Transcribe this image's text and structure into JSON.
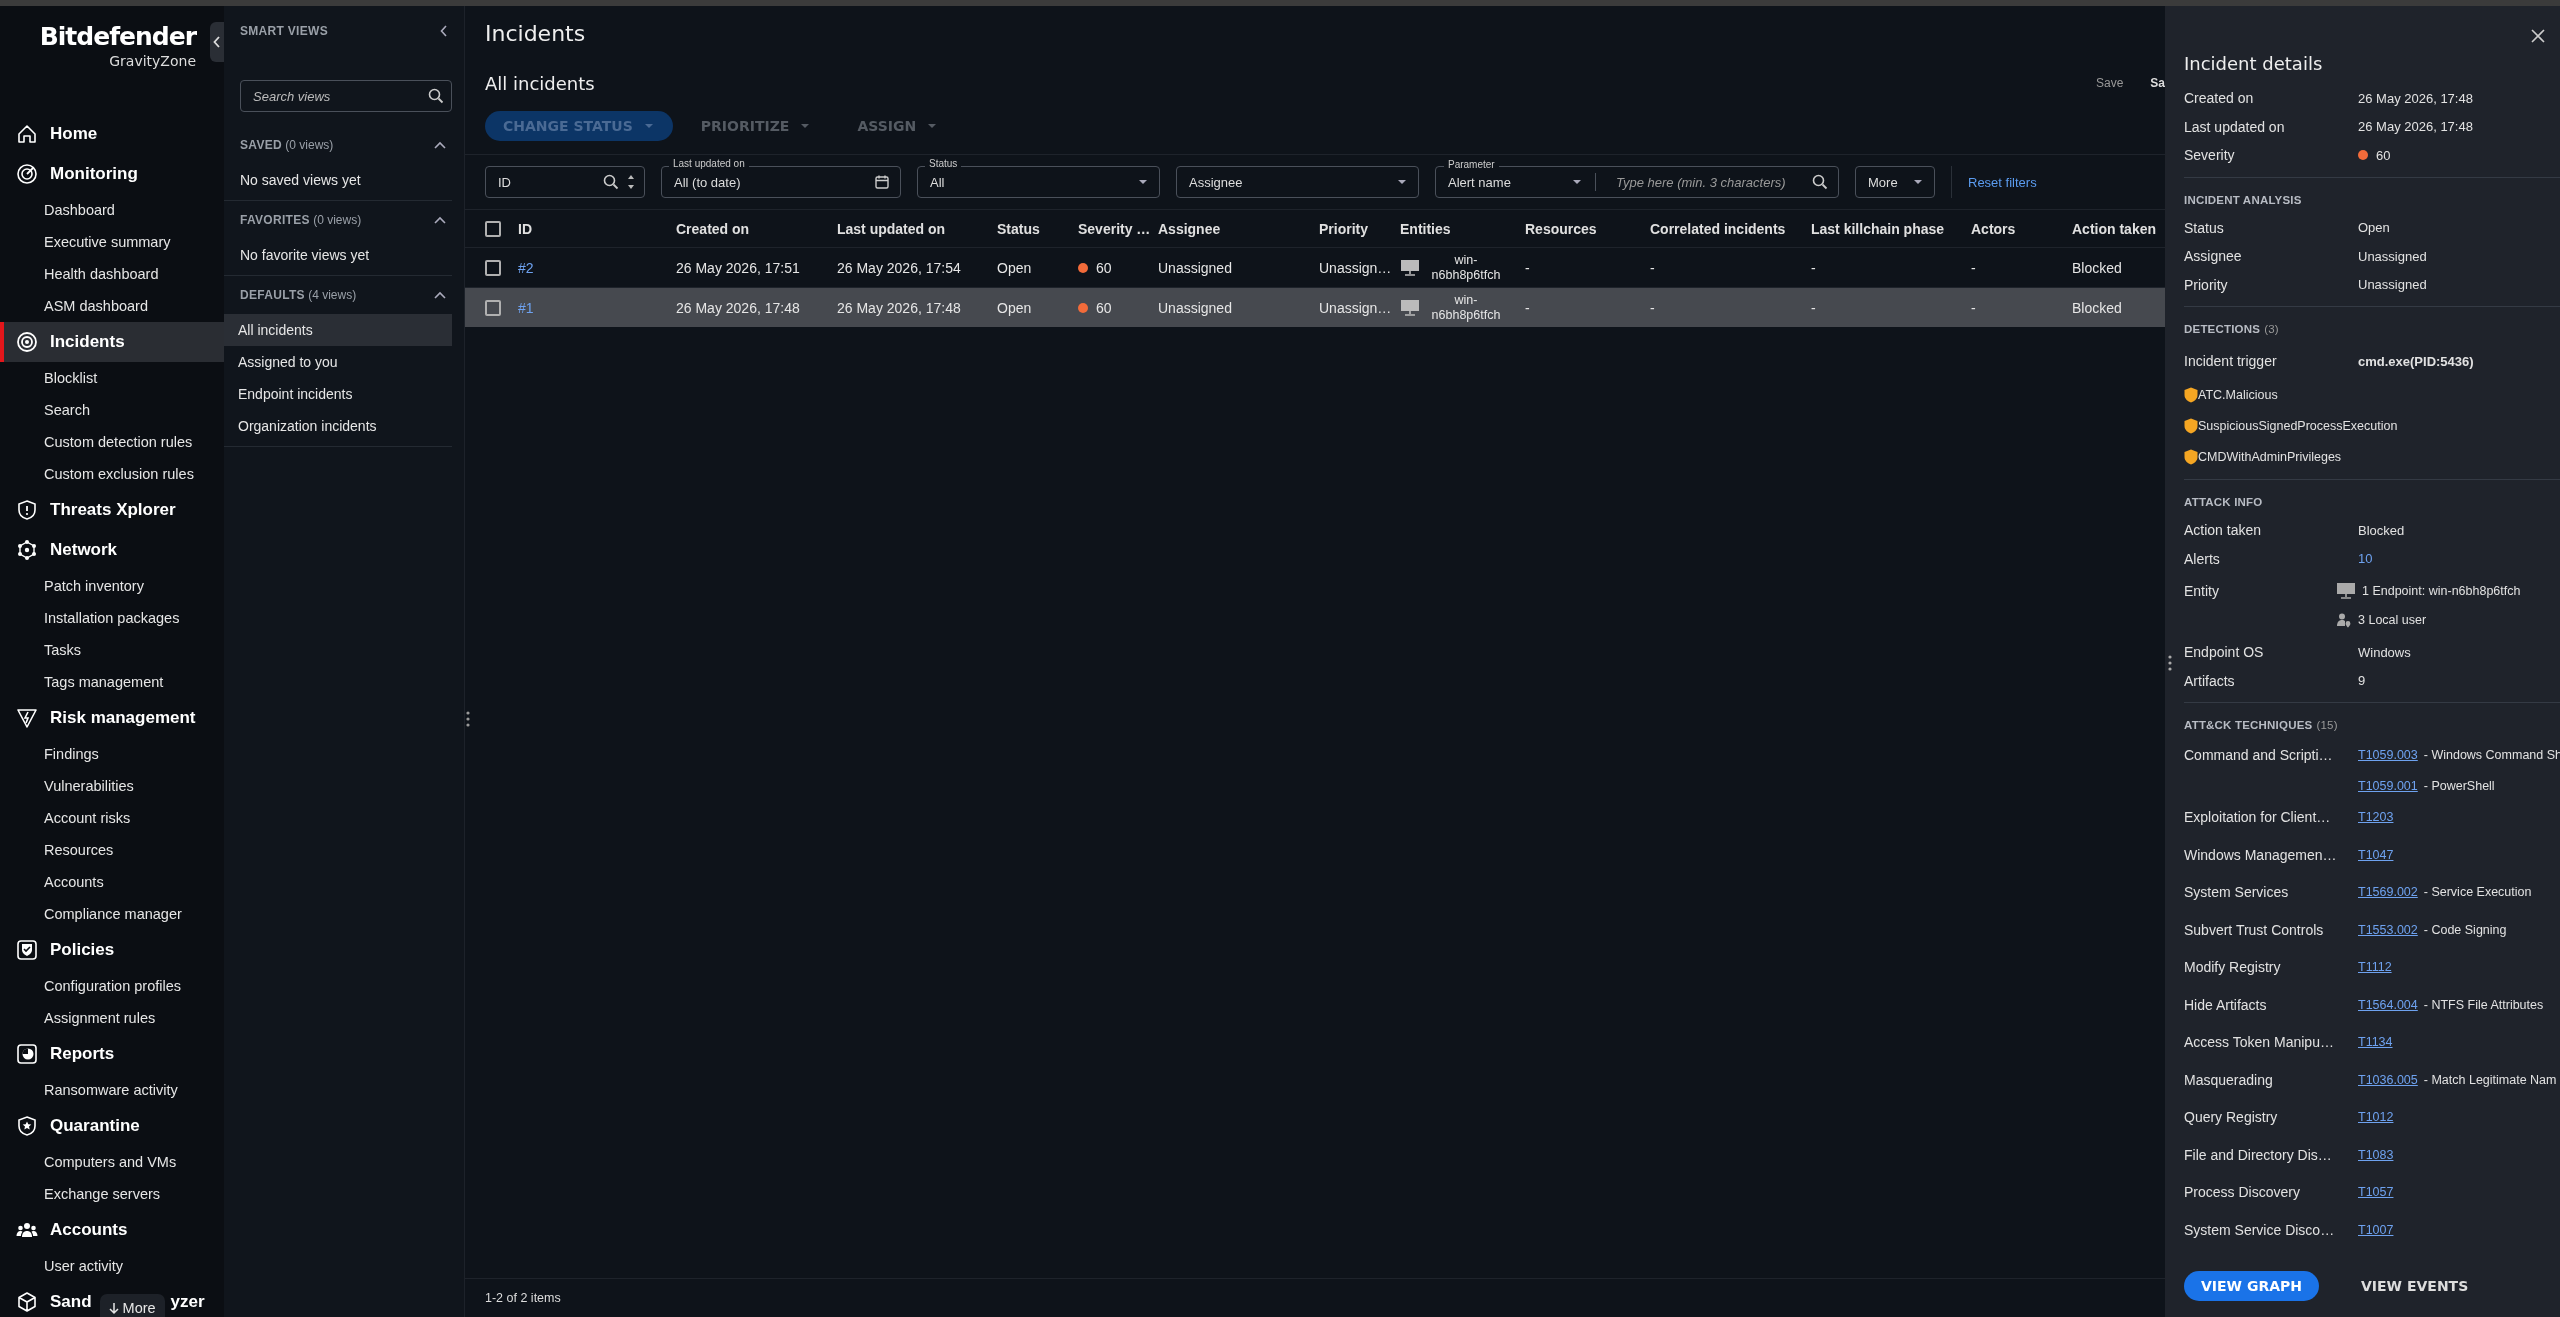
{
  "nav": {
    "brand": "Bitdefender",
    "product": "GravityZone",
    "more": "More",
    "sections": [
      {
        "label": "Home",
        "selected": false
      },
      {
        "label": "Monitoring",
        "selected": false,
        "items": [
          "Dashboard",
          "Executive summary",
          "Health dashboard",
          "ASM dashboard"
        ]
      },
      {
        "label": "Incidents",
        "selected": true,
        "items": [
          "Blocklist",
          "Search",
          "Custom detection rules",
          "Custom exclusion rules"
        ]
      },
      {
        "label": "Threats Xplorer",
        "selected": false
      },
      {
        "label": "Network",
        "selected": false,
        "items": [
          "Patch inventory",
          "Installation packages",
          "Tasks",
          "Tags management"
        ]
      },
      {
        "label": "Risk management",
        "selected": false,
        "items": [
          "Findings",
          "Vulnerabilities",
          "Account risks",
          "Resources",
          "Accounts",
          "Compliance manager"
        ]
      },
      {
        "label": "Policies",
        "selected": false,
        "items": [
          "Configuration profiles",
          "Assignment rules"
        ]
      },
      {
        "label": "Reports",
        "selected": false,
        "items": [
          "Ransomware activity"
        ]
      },
      {
        "label": "Quarantine",
        "selected": false,
        "items": [
          "Computers and VMs",
          "Exchange servers"
        ]
      },
      {
        "label": "Accounts",
        "selected": false,
        "items": [
          "User activity"
        ]
      },
      {
        "label": "Sand",
        "label_tail": "yzer",
        "selected": false
      }
    ]
  },
  "smart_views": {
    "title": "SMART VIEWS",
    "search": {
      "placeholder": "Search views"
    },
    "groups": [
      {
        "title": "SAVED",
        "count": "(0 views)",
        "expanded": true,
        "empty_text": "No saved views yet"
      },
      {
        "title": "FAVORITES",
        "count": "(0 views)",
        "expanded": true,
        "empty_text": "No favorite views yet"
      },
      {
        "title": "DEFAULTS",
        "count": "(4 views)",
        "expanded": true,
        "items": [
          {
            "label": "All incidents",
            "selected": true
          },
          {
            "label": "Assigned to you",
            "selected": false
          },
          {
            "label": "Endpoint incidents",
            "selected": false
          },
          {
            "label": "Organization incidents",
            "selected": false
          }
        ]
      }
    ]
  },
  "main": {
    "title": "Incidents",
    "view_title": "All incidents",
    "view_actions": [
      "Save",
      "Sa"
    ],
    "actions": [
      {
        "label": "CHANGE STATUS",
        "kind": "filled",
        "disabled": true
      },
      {
        "label": "PRIORITIZE",
        "kind": "text",
        "disabled": true
      },
      {
        "label": "ASSIGN",
        "kind": "text",
        "disabled": true
      }
    ],
    "filters": [
      {
        "kind": "id",
        "placeholder": "ID"
      },
      {
        "kind": "date",
        "label": "Last updated on",
        "value": "All (to date)"
      },
      {
        "kind": "select",
        "label": "Status",
        "value": "All"
      },
      {
        "kind": "select",
        "placeholder": "Assignee"
      },
      {
        "kind": "parameter",
        "label": "Parameter",
        "value": "Alert name",
        "placeholder": "Type here (min. 3 characters)"
      },
      {
        "kind": "menu",
        "value": "More"
      },
      {
        "kind": "link",
        "value": "Reset filters"
      }
    ],
    "table": {
      "all_checked": false,
      "columns": [
        "ID",
        "Created on",
        "Last updated on",
        "Status",
        "Severity …",
        "Assignee",
        "Priority",
        "Entities",
        "Resources",
        "Correlated incidents",
        "Last killchain phase",
        "Actors",
        "Action taken"
      ],
      "rows": [
        {
          "selected": false,
          "checked": false,
          "id": "#2",
          "created": "26 May 2026, 17:51",
          "updated": "26 May 2026, 17:54",
          "status": "Open",
          "severity": {
            "value": "60",
            "color": "#f26b3a"
          },
          "assignee": "Unassigned",
          "priority": "Unassign…",
          "entity": "win-n6bh8p6tfch",
          "resources": "-",
          "correlated": "-",
          "killchain": "-",
          "actors": "-",
          "action": "Blocked"
        },
        {
          "selected": true,
          "checked": false,
          "id": "#1",
          "created": "26 May 2026, 17:48",
          "updated": "26 May 2026, 17:48",
          "status": "Open",
          "severity": {
            "value": "60",
            "color": "#f26b3a"
          },
          "assignee": "Unassigned",
          "priority": "Unassign…",
          "entity": "win-n6bh8p6tfch",
          "resources": "-",
          "correlated": "-",
          "killchain": "-",
          "actors": "-",
          "action": "Blocked"
        }
      ]
    },
    "footer": "1-2 of 2 items"
  },
  "details": {
    "title": "Incident details",
    "summary": [
      {
        "label": "Created on",
        "kind": "text",
        "value": "26 May 2026, 17:48"
      },
      {
        "label": "Last updated on",
        "kind": "text",
        "value": "26 May 2026, 17:48"
      },
      {
        "label": "Severity",
        "kind": "severity",
        "value": "60",
        "color": "#f26b3a"
      }
    ],
    "sections": [
      {
        "kind": "fields",
        "title": "INCIDENT ANALYSIS",
        "rows": [
          {
            "label": "Status",
            "kind": "text",
            "value": "Open"
          },
          {
            "label": "Assignee",
            "kind": "text",
            "value": "Unassigned"
          },
          {
            "label": "Priority",
            "kind": "text",
            "value": "Unassigned"
          }
        ]
      },
      {
        "kind": "detections",
        "title": "DETECTIONS",
        "count": "(3)",
        "trigger": {
          "label": "Incident trigger",
          "value": "cmd.exe(PID:5436)"
        },
        "items": [
          "ATC.Malicious",
          "SuspiciousSignedProcessExecution",
          "CMDWithAdminPrivileges"
        ]
      },
      {
        "kind": "fields",
        "title": "ATTACK INFO",
        "rows": [
          {
            "label": "Action taken",
            "kind": "text",
            "value": "Blocked"
          },
          {
            "label": "Alerts",
            "kind": "link",
            "value": "10"
          },
          {
            "label": "Entity",
            "kind": "entities",
            "entities": [
              {
                "kind": "endpoint",
                "text": "1 Endpoint: win-n6bh8p6tfch"
              },
              {
                "kind": "user",
                "text": "3 Local user"
              }
            ]
          },
          {
            "label": "Endpoint OS",
            "kind": "text",
            "value": "Windows"
          },
          {
            "label": "Artifacts",
            "kind": "text",
            "value": "9"
          }
        ]
      },
      {
        "kind": "techniques",
        "title": "ATT&CK TECHNIQUES",
        "count": "(15)",
        "items": [
          {
            "name": "Command and Scripti…",
            "techniques": [
              {
                "id": "T1059.003",
                "desc": "- Windows Command Sh"
              },
              {
                "id": "T1059.001",
                "desc": "- PowerShell"
              }
            ]
          },
          {
            "name": "Exploitation for Client…",
            "techniques": [
              {
                "id": "T1203"
              }
            ]
          },
          {
            "name": "Windows Managemen…",
            "techniques": [
              {
                "id": "T1047"
              }
            ]
          },
          {
            "name": "System Services",
            "techniques": [
              {
                "id": "T1569.002",
                "desc": "- Service Execution"
              }
            ]
          },
          {
            "name": "Subvert Trust Controls",
            "techniques": [
              {
                "id": "T1553.002",
                "desc": "- Code Signing"
              }
            ]
          },
          {
            "name": "Modify Registry",
            "techniques": [
              {
                "id": "T1112"
              }
            ]
          },
          {
            "name": "Hide Artifacts",
            "techniques": [
              {
                "id": "T1564.004",
                "desc": "- NTFS File Attributes"
              }
            ]
          },
          {
            "name": "Access Token Manipu…",
            "techniques": [
              {
                "id": "T1134"
              }
            ]
          },
          {
            "name": "Masquerading",
            "techniques": [
              {
                "id": "T1036.005",
                "desc": "- Match Legitimate Nam"
              }
            ]
          },
          {
            "name": "Query Registry",
            "techniques": [
              {
                "id": "T1012"
              }
            ]
          },
          {
            "name": "File and Directory Dis…",
            "techniques": [
              {
                "id": "T1083"
              }
            ]
          },
          {
            "name": "Process Discovery",
            "techniques": [
              {
                "id": "T1057"
              }
            ]
          },
          {
            "name": "System Service Disco…",
            "techniques": [
              {
                "id": "T1007"
              }
            ]
          }
        ]
      }
    ],
    "buttons": [
      {
        "label": "VIEW GRAPH",
        "kind": "primary"
      },
      {
        "label": "VIEW EVENTS",
        "kind": "text"
      }
    ]
  }
}
